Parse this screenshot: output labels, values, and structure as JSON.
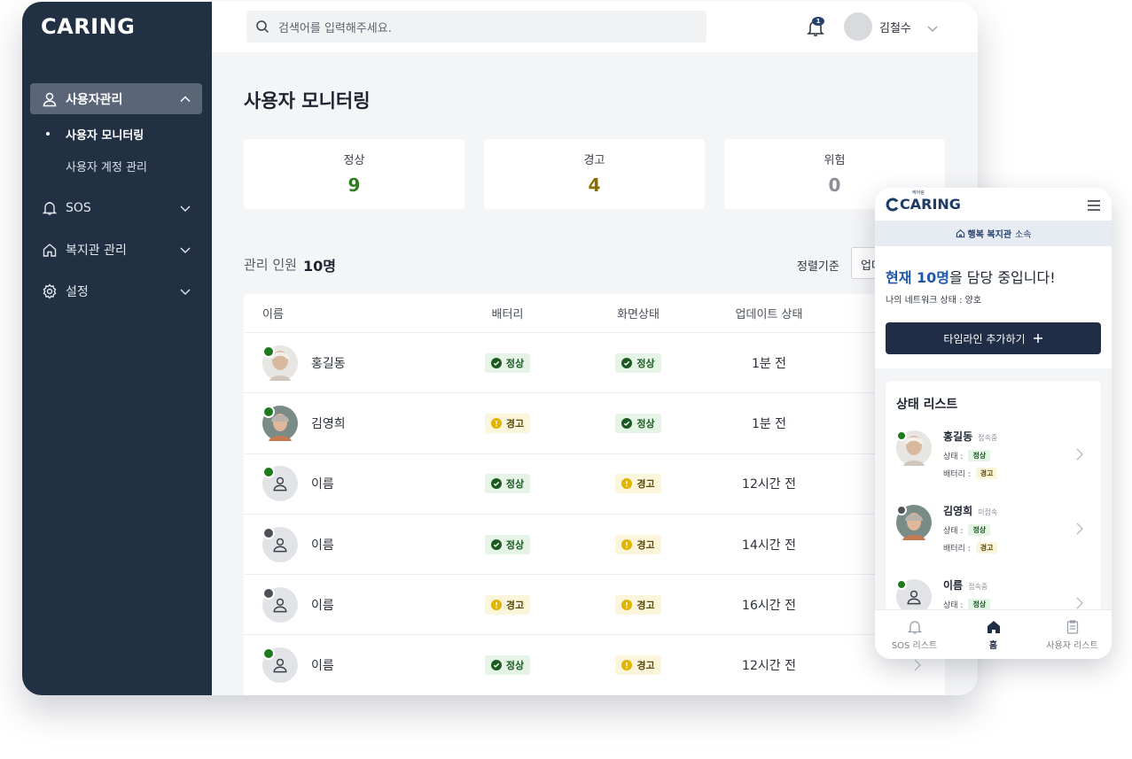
{
  "app": {
    "logo": "CARING"
  },
  "sidebar": {
    "groups": [
      {
        "label": "사용자관리",
        "icon": "user-icon",
        "expanded": true
      },
      {
        "label": "SOS",
        "icon": "bell-icon",
        "expanded": false
      },
      {
        "label": "복지관 관리",
        "icon": "home-icon",
        "expanded": false
      },
      {
        "label": "설정",
        "icon": "gear-icon",
        "expanded": false
      }
    ],
    "sub_items": [
      {
        "label": "사용자 모니터링",
        "current": true
      },
      {
        "label": "사용자 계정 관리",
        "current": false
      }
    ]
  },
  "header": {
    "search_placeholder": "검색어를 입력해주세요.",
    "notification_count": "1",
    "user_name": "김철수"
  },
  "page": {
    "title": "사용자 모니터링",
    "stats": [
      {
        "label": "정상",
        "value": "9",
        "color": "#2e7d1f"
      },
      {
        "label": "경고",
        "value": "4",
        "color": "#8a6d00"
      },
      {
        "label": "위험",
        "value": "0",
        "color": "#8a8f96"
      }
    ],
    "count_label": "관리 인원",
    "count_value": "10명",
    "sort_label": "정렬기준",
    "sort_value": "업데이트순"
  },
  "table": {
    "columns": [
      "이름",
      "배터리",
      "화면상태",
      "업데이트 상태"
    ],
    "rows": [
      {
        "name": "홍길동",
        "online": true,
        "photo": "elder-man-photo",
        "battery": "정상",
        "screen": "정상",
        "updated": "1분 전"
      },
      {
        "name": "김영희",
        "online": true,
        "photo": "elder-woman-photo",
        "battery": "경고",
        "screen": "정상",
        "updated": "1분 전"
      },
      {
        "name": "이름",
        "online": true,
        "photo": "default-user",
        "battery": "정상",
        "screen": "경고",
        "updated": "12시간 전"
      },
      {
        "name": "이름",
        "online": false,
        "photo": "default-user",
        "battery": "정상",
        "screen": "경고",
        "updated": "14시간 전"
      },
      {
        "name": "이름",
        "online": false,
        "photo": "default-user",
        "battery": "경고",
        "screen": "경고",
        "updated": "16시간 전"
      },
      {
        "name": "이름",
        "online": true,
        "photo": "default-user",
        "battery": "정상",
        "screen": "경고",
        "updated": "12시간 전"
      }
    ]
  },
  "mobile": {
    "logo": "CARING",
    "logo_sub": "케어링",
    "org_name": "행복 복지관",
    "org_suffix": "소속",
    "hello_prefix": "현재 10명",
    "hello_suffix": "을 담당 중입니다!",
    "network_status": "나의 네트워크 상태 : 양호",
    "add_button": "타임라인 추가하기",
    "list_title": "상태 리스트",
    "status_label": "상태 :",
    "battery_label": "배터리 :",
    "items": [
      {
        "name": "홍길동",
        "conn": "접속중",
        "online": true,
        "status": "정상",
        "battery": "경고"
      },
      {
        "name": "김영희",
        "conn": "미접속",
        "online": false,
        "status": "정상",
        "battery": "경고"
      },
      {
        "name": "이름",
        "conn": "접속중",
        "online": true,
        "status": "정상",
        "battery": ""
      }
    ],
    "tabs": [
      {
        "label": "SOS 리스트",
        "active": false
      },
      {
        "label": "홈",
        "active": true
      },
      {
        "label": "사용자 리스트",
        "active": false
      }
    ]
  },
  "colors": {
    "sidebar": "#223043",
    "online": "#1f7a1f",
    "offline": "#4d5258",
    "accent": "#1f58a8"
  }
}
